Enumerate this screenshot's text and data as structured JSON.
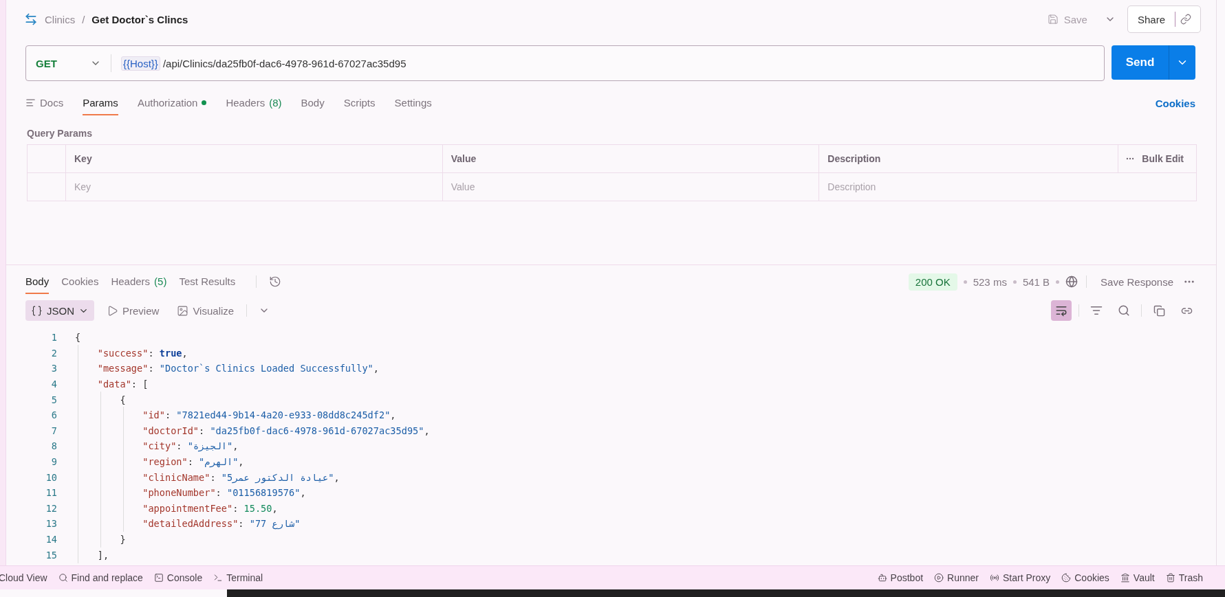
{
  "breadcrumb": {
    "parent": "Clinics",
    "separator": "/",
    "current": "Get Doctor`s Clincs"
  },
  "header_actions": {
    "save": "Save",
    "share": "Share"
  },
  "request": {
    "method": "GET",
    "variable": "{{Host}}",
    "path": "/api/Clinics/da25fb0f-dac6-4978-961d-67027ac35d95",
    "send": "Send"
  },
  "request_tabs": [
    {
      "label": "Docs",
      "selected": false,
      "dot": false
    },
    {
      "label": "Params",
      "selected": true,
      "dot": false
    },
    {
      "label": "Authorization",
      "selected": false,
      "dot": true
    },
    {
      "label": "Headers",
      "count": "(8)",
      "selected": false,
      "dot": false
    },
    {
      "label": "Body",
      "selected": false,
      "dot": false
    },
    {
      "label": "Scripts",
      "selected": false,
      "dot": false
    },
    {
      "label": "Settings",
      "selected": false,
      "dot": false
    }
  ],
  "cookies_link": "Cookies",
  "query_params": {
    "title": "Query Params",
    "columns": [
      "Key",
      "Value",
      "Description"
    ],
    "bulk_edit": "Bulk Edit",
    "placeholders": [
      "Key",
      "Value",
      "Description"
    ]
  },
  "response_tabs": [
    {
      "label": "Body",
      "selected": true
    },
    {
      "label": "Cookies",
      "selected": false
    },
    {
      "label": "Headers",
      "count": "(5)",
      "selected": false
    },
    {
      "label": "Test Results",
      "selected": false
    }
  ],
  "response_status": {
    "status": "200 OK",
    "time": "523 ms",
    "size": "541 B",
    "save_response": "Save Response"
  },
  "view_modes": [
    {
      "label": "JSON",
      "selected": true
    },
    {
      "label": "Preview",
      "selected": false
    },
    {
      "label": "Visualize",
      "selected": false
    }
  ],
  "wrap_enabled": true,
  "code_lines": [
    {
      "number": "1",
      "tokens": [
        {
          "kind": "punct",
          "text": "{"
        }
      ]
    },
    {
      "number": "2",
      "tokens": [
        {
          "kind": "key",
          "text": "    \"success\""
        },
        {
          "kind": "punct",
          "text": ": "
        },
        {
          "kind": "bool",
          "text": "true"
        },
        {
          "kind": "punct",
          "text": ","
        }
      ]
    },
    {
      "number": "3",
      "tokens": [
        {
          "kind": "key",
          "text": "    \"message\""
        },
        {
          "kind": "punct",
          "text": ": "
        },
        {
          "kind": "string",
          "text": "\"Doctor`s Clinics Loaded Successfully\""
        },
        {
          "kind": "punct",
          "text": ","
        }
      ]
    },
    {
      "number": "4",
      "tokens": [
        {
          "kind": "key",
          "text": "    \"data\""
        },
        {
          "kind": "punct",
          "text": ": ["
        }
      ]
    },
    {
      "number": "5",
      "tokens": [
        {
          "kind": "punct",
          "text": "        {"
        }
      ]
    },
    {
      "number": "6",
      "tokens": [
        {
          "kind": "key",
          "text": "            \"id\""
        },
        {
          "kind": "punct",
          "text": ": "
        },
        {
          "kind": "string",
          "text": "\"7821ed44-9b14-4a20-e933-08dd8c245df2\""
        },
        {
          "kind": "punct",
          "text": ","
        }
      ]
    },
    {
      "number": "7",
      "tokens": [
        {
          "kind": "key",
          "text": "            \"doctorId\""
        },
        {
          "kind": "punct",
          "text": ": "
        },
        {
          "kind": "string",
          "text": "\"da25fb0f-dac6-4978-961d-67027ac35d95\""
        },
        {
          "kind": "punct",
          "text": ","
        }
      ]
    },
    {
      "number": "8",
      "tokens": [
        {
          "kind": "key",
          "text": "            \"city\""
        },
        {
          "kind": "punct",
          "text": ": "
        },
        {
          "kind": "string",
          "text": "\"الجيزة\""
        },
        {
          "kind": "punct",
          "text": ","
        }
      ]
    },
    {
      "number": "9",
      "tokens": [
        {
          "kind": "key",
          "text": "            \"region\""
        },
        {
          "kind": "punct",
          "text": ": "
        },
        {
          "kind": "string",
          "text": "\"الهرم\""
        },
        {
          "kind": "punct",
          "text": ","
        }
      ]
    },
    {
      "number": "10",
      "tokens": [
        {
          "kind": "key",
          "text": "            \"clinicName\""
        },
        {
          "kind": "punct",
          "text": ": "
        },
        {
          "kind": "string",
          "text": "\"عيادة الدكتور عمر5\""
        },
        {
          "kind": "punct",
          "text": ","
        }
      ]
    },
    {
      "number": "11",
      "tokens": [
        {
          "kind": "key",
          "text": "            \"phoneNumber\""
        },
        {
          "kind": "punct",
          "text": ": "
        },
        {
          "kind": "string",
          "text": "\"01156819576\""
        },
        {
          "kind": "punct",
          "text": ","
        }
      ]
    },
    {
      "number": "12",
      "tokens": [
        {
          "kind": "key",
          "text": "            \"appointmentFee\""
        },
        {
          "kind": "punct",
          "text": ": "
        },
        {
          "kind": "number",
          "text": "15.50"
        },
        {
          "kind": "punct",
          "text": ","
        }
      ]
    },
    {
      "number": "13",
      "tokens": [
        {
          "kind": "key",
          "text": "            \"detailedAddress\""
        },
        {
          "kind": "punct",
          "text": ": "
        },
        {
          "kind": "string",
          "text": "\"77 شارع\""
        }
      ]
    },
    {
      "number": "14",
      "tokens": [
        {
          "kind": "punct",
          "text": "        }"
        }
      ]
    },
    {
      "number": "15",
      "tokens": [
        {
          "kind": "punct",
          "text": "    ],"
        }
      ]
    }
  ],
  "status_bar": {
    "left": [
      {
        "label": "Cloud View",
        "kind": "plain"
      },
      {
        "label": "Find and replace",
        "kind": "search"
      },
      {
        "label": "Console",
        "kind": "console"
      },
      {
        "label": "Terminal",
        "kind": "terminal"
      }
    ],
    "right": [
      {
        "label": "Postbot",
        "kind": "bot"
      },
      {
        "label": "Runner",
        "kind": "runner"
      },
      {
        "label": "Start Proxy",
        "kind": "proxy"
      },
      {
        "label": "Cookies",
        "kind": "cookie"
      },
      {
        "label": "Vault",
        "kind": "vault"
      },
      {
        "label": "Trash",
        "kind": "trash"
      }
    ]
  }
}
